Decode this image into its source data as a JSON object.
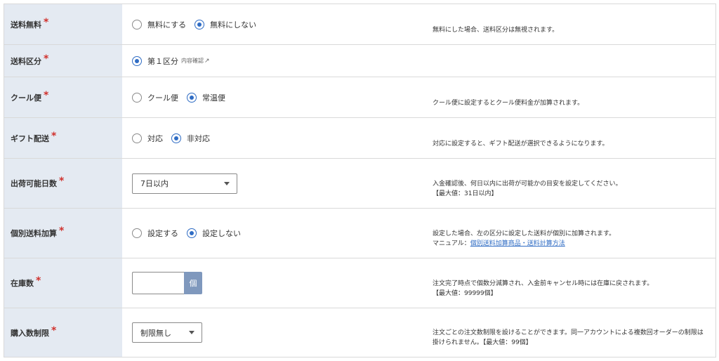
{
  "required_mark": "*",
  "rows": {
    "free_shipping": {
      "label": "送料無料",
      "options": [
        "無料にする",
        "無料にしない"
      ],
      "selected": 1,
      "help": "無料にした場合、送料区分は無視されます。"
    },
    "shipping_class": {
      "label": "送料区分",
      "option": "第１区分",
      "link": "内容確認",
      "help": ""
    },
    "cool": {
      "label": "クール便",
      "options": [
        "クール便",
        "常温便"
      ],
      "selected": 1,
      "help": "クール便に設定するとクール便料金が加算されます。"
    },
    "gift": {
      "label": "ギフト配送",
      "options": [
        "対応",
        "非対応"
      ],
      "selected": 1,
      "help": "対応に設定すると、ギフト配送が選択できるようになります。"
    },
    "ship_days": {
      "label": "出荷可能日数",
      "value": "7日以内",
      "help1": "入金確認後、何日以内に出荷が可能かの目安を設定してください。",
      "help2": "【最大値：31日以内】"
    },
    "individual_fee": {
      "label": "個別送料加算",
      "options": [
        "設定する",
        "設定しない"
      ],
      "selected": 1,
      "help1": "設定した場合、左の区分に設定した送料が個別に加算されます。",
      "help2_prefix": "マニュアル：",
      "help2_link": "個別送料加算商品・送料計算方法"
    },
    "stock": {
      "label": "在庫数",
      "value": "",
      "unit": "個",
      "help1": "注文完了時点で個数分減算され、入金前キャンセル時には在庫に戻されます。",
      "help2": "【最大値：99999個】"
    },
    "purchase_limit": {
      "label": "購入数制限",
      "value": "制限無し",
      "help1": "注文ごとの注文数制限を設けることができます。同一アカウントによる複数回オーダーの制限は",
      "help2": "掛けられません。【最大値：99個】"
    }
  }
}
